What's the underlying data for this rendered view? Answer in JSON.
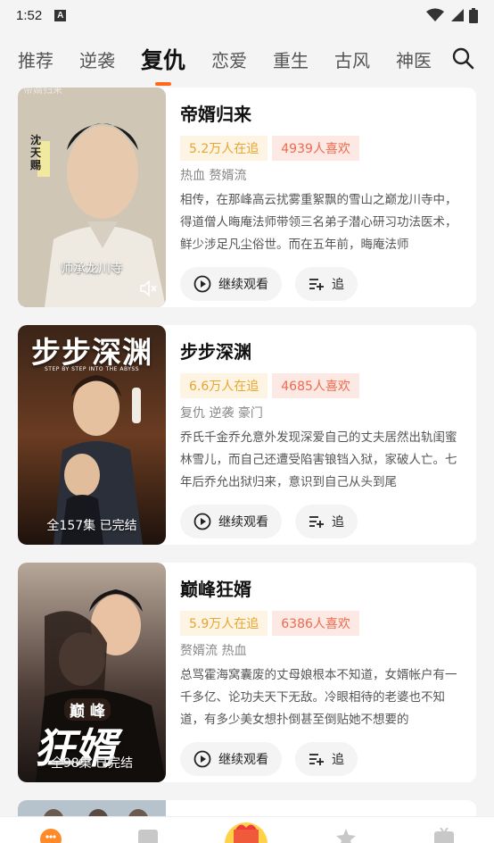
{
  "status": {
    "time": "1:52",
    "notification": "A"
  },
  "tabs": [
    {
      "label": "推荐",
      "active": false
    },
    {
      "label": "逆袭",
      "active": false
    },
    {
      "label": "复仇",
      "active": true
    },
    {
      "label": "恋爱",
      "active": false
    },
    {
      "label": "重生",
      "active": false
    },
    {
      "label": "古风",
      "active": false
    },
    {
      "label": "神医",
      "active": false
    }
  ],
  "cards": [
    {
      "title": "帝婿归来",
      "watching": "5.2万人在追",
      "likes": "4939人喜欢",
      "tags": "热血 赘婿流",
      "description": "相传，在那峰高云扰雾重絮飘的雪山之巅龙川寺中，得道僧人晦庵法师带领三名弟子潜心研习功法医术，鲜少涉足凡尘俗世。而在五年前，晦庵法师",
      "poster_caption": "师承龙川寺",
      "poster_small_text": "帝婿归来",
      "poster_tag": "沈天赐",
      "play_label": "继续观看",
      "follow_label": "追"
    },
    {
      "title": "步步深渊",
      "watching": "6.6万人在追",
      "likes": "4685人喜欢",
      "tags": "复仇 逆袭 豪门",
      "description": "乔氏千金乔允意外发现深爱自己的丈夫居然出轨闺蜜林雪儿，而自己还遭受陷害锒铛入狱，家破人亡。七年后乔允出狱归来，意识到自己从头到尾",
      "poster_caption": "全157集  已完结",
      "poster_title": "步步深渊",
      "poster_subtitle": "STEP BY STEP INTO THE ABYSS",
      "play_label": "继续观看",
      "follow_label": "追"
    },
    {
      "title": "巅峰狂婿",
      "watching": "5.9万人在追",
      "likes": "6386人喜欢",
      "tags": "赘婿流 热血",
      "description": "总骂霍海窝囊废的丈母娘根本不知道，女婿帐户有一千多亿、论功夫天下无敌。冷眼相待的老婆也不知道，有多少美女想扑倒甚至倒贴她不想要的",
      "poster_caption": "全98集  已完结",
      "poster_title_top": "巅 峰",
      "poster_title_main": "狂婿",
      "play_label": "继续观看",
      "follow_label": "追"
    }
  ],
  "colors": {
    "accent": "#ff6a1a",
    "watch_badge_text": "#e8a530",
    "like_badge_text": "#ee6a50",
    "background": "#f4f4f4"
  },
  "icons": [
    "search-icon",
    "mute-icon",
    "play-circle-icon",
    "add-list-icon",
    "home-icon",
    "library-icon",
    "gift-icon",
    "star-icon",
    "tv-icon"
  ]
}
